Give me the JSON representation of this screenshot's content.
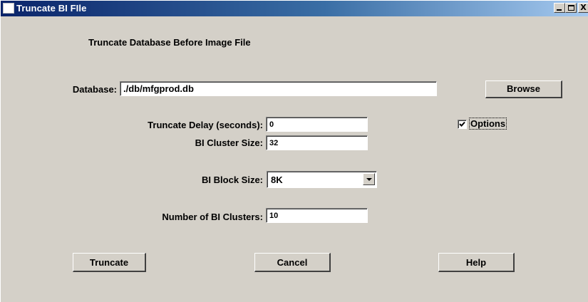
{
  "window": {
    "title": "Truncate BI FIle",
    "controls": {
      "minimize": "_",
      "maximize": "□",
      "close": "X"
    }
  },
  "heading": "Truncate Database Before Image File",
  "database": {
    "label": "Database:",
    "value": "./db/mfgprod.db",
    "browse_label": "Browse"
  },
  "truncate_delay": {
    "label": "Truncate Delay (seconds):",
    "value": "0"
  },
  "options": {
    "label": "Options",
    "checked": true
  },
  "bi_cluster_size": {
    "label": "BI Cluster Size:",
    "value": "32"
  },
  "bi_block_size": {
    "label": "BI Block Size:",
    "value": "8K"
  },
  "number_of_bi_clusters": {
    "label": "Number of BI Clusters:",
    "value": "10"
  },
  "buttons": {
    "truncate": "Truncate",
    "cancel": "Cancel",
    "help": "Help"
  }
}
